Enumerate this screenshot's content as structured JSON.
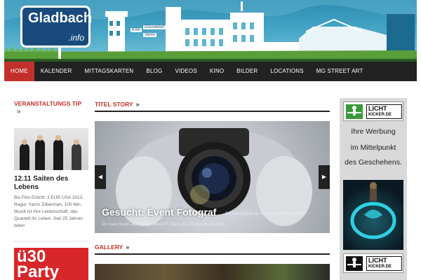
{
  "header": {
    "logo_text": "Gladbach",
    "logo_sub": ".info",
    "sign_1": "Köln",
    "sign_2": "Düsseldorf",
    "sign_3": "Venlo"
  },
  "nav": {
    "items": [
      "Home",
      "Kalender",
      "Mittagskarten",
      "Blog",
      "Videos",
      "Kino",
      "Bilder",
      "Locations",
      "MG Street Art"
    ],
    "active_index": 0
  },
  "sidebar_left": {
    "title": "Veranstaltungs Tip",
    "event_title": "12.11 Saiten des Lebens",
    "event_desc": "Bis Film Eintritt: 3 EUR USA 2013. Regie: Yaron Zilberman, 105 Min. Musik ist ihre Leidenschaft, das Quartett ihr Leben. Seit 25 Jahren teilen",
    "ad_text": "ü30 Party"
  },
  "main": {
    "titel_story": "Titel Story",
    "slide_title": "Gesucht: Event Fotograf",
    "slide_title_side": "Du hast Spaß an Partys oder Konzerte?",
    "slide_sub": "Du hast Spaß am Fotografieren? Dann bist du genau der/die...",
    "gallery": "Gallery",
    "prev_arrow": "◀",
    "next_arrow": "▶"
  },
  "ad_right": {
    "brand_line1": "LICHT",
    "brand_line2": "KICKER.DE",
    "line1": "Ihre Werbung",
    "line2": "im Mittelpunkt",
    "line3": "des Geschehens."
  },
  "colors": {
    "accent": "#c3302b",
    "nav_bg": "#222222",
    "sky": "#2d8bb0",
    "logo_sign": "#184a7e",
    "brand_green": "#3a9a3a"
  }
}
